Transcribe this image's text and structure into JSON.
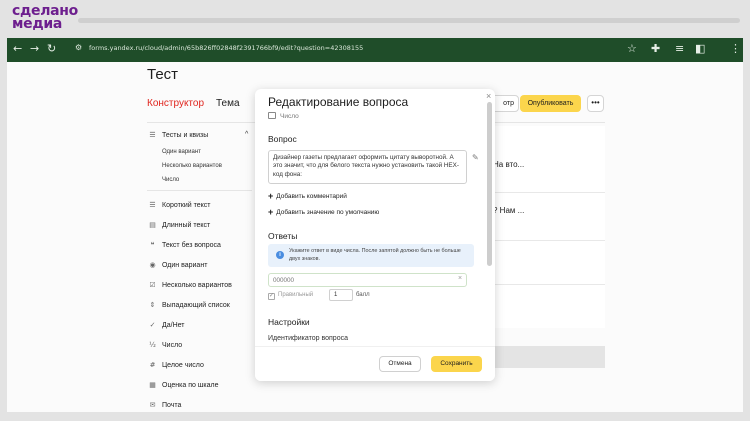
{
  "brand": {
    "line1": "сделано",
    "line2": "медиа"
  },
  "browser": {
    "url": "forms.yandex.ru/cloud/admin/65b826ff02848f2391766bf9/edit?question=42308155",
    "icons": [
      "back-arrow",
      "forward-arrow",
      "reload",
      "site-info",
      "star",
      "extensions",
      "playlist",
      "sidebar",
      "more"
    ]
  },
  "page": {
    "title": "Тест",
    "tabs": [
      "Конструктор",
      "Тема"
    ],
    "preview_label": "отр",
    "publish_label": "Опубликовать",
    "more_label": "•••"
  },
  "sidebar": {
    "group_label": "Тесты и квизы",
    "sub_items": [
      "Один вариант",
      "Несколько вариантов",
      "Число"
    ],
    "items": [
      {
        "icon": "short-text-icon",
        "glyph": "☰",
        "label": "Короткий текст"
      },
      {
        "icon": "long-text-icon",
        "glyph": "▤",
        "label": "Длинный текст"
      },
      {
        "icon": "quote-icon",
        "glyph": "❝",
        "label": "Текст без вопроса"
      },
      {
        "icon": "radio-icon",
        "glyph": "◉",
        "label": "Один вариант"
      },
      {
        "icon": "checkbox-icon",
        "glyph": "☑",
        "label": "Несколько вариантов"
      },
      {
        "icon": "dropdown-icon",
        "glyph": "⇕",
        "label": "Выпадающий список"
      },
      {
        "icon": "check-icon",
        "glyph": "✓",
        "label": "Да/Нет"
      },
      {
        "icon": "fraction-icon",
        "glyph": "½",
        "label": "Число"
      },
      {
        "icon": "hash-icon",
        "glyph": "#",
        "label": "Целое число"
      },
      {
        "icon": "grid-icon",
        "glyph": "▦",
        "label": "Оценка по шкале"
      },
      {
        "icon": "mail-icon",
        "glyph": "✉",
        "label": "Почта"
      }
    ]
  },
  "right_card": {
    "q1": "На вто...",
    "q2": "? Нам ..."
  },
  "modal": {
    "title": "Редактирование вопроса",
    "type": "Число",
    "question_heading": "Вопрос",
    "question_text": "Дизайнер газеты предлагает оформить цитату выворотной. А это значит, что для белого текста нужно установить такой HEX-код фона:",
    "add_comment": "Добавить комментарий",
    "add_default": "Добавить значение по умолчанию",
    "answers_heading": "Ответы",
    "info_text": "Укажите ответ в виде числа. После запятой должно быть не больше двух знаков.",
    "answer_value": "000000",
    "correct_label": "Правильный",
    "score_value": "1",
    "score_label": "балл",
    "settings_heading": "Настройки",
    "id_label": "Идентификатор вопроса",
    "cancel_label": "Отмена",
    "save_label": "Сохранить"
  },
  "colors": {
    "accent": "#fbd54c",
    "brand": "#6d1f8e",
    "browser_bar": "#1f4d29",
    "active_tab": "#e0261f"
  }
}
